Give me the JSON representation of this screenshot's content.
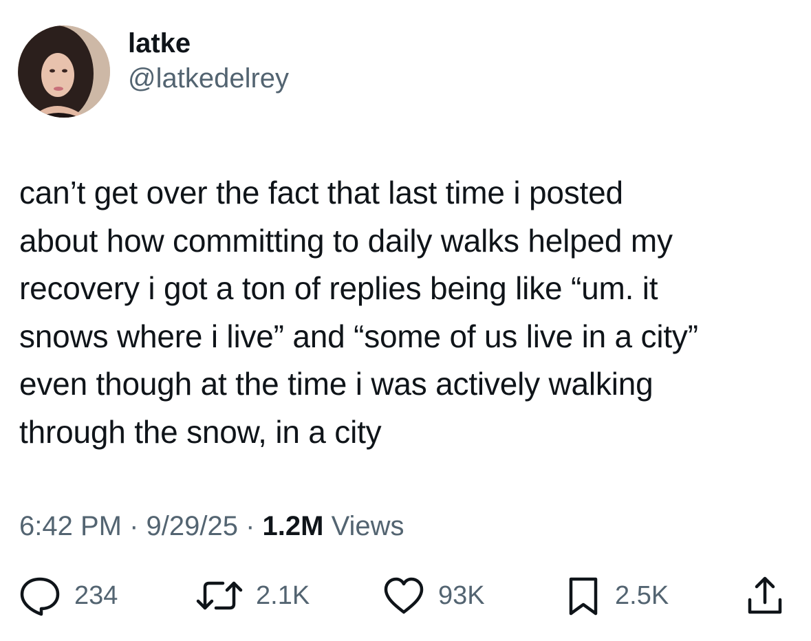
{
  "user": {
    "display_name": "latke",
    "handle": "@latkedelrey"
  },
  "tweet": {
    "text": "can’t get over the fact that last time i posted\nabout how committing to daily walks helped my\nrecovery i got a ton of replies being like “um. it\nsnows where i live” and “some of us live in a city”\neven though at the time i was actively walking\nthrough the snow, in a city",
    "time": "6:42 PM",
    "date": "9/29/25",
    "separator": " · ",
    "views_count": "1.2M",
    "views_label": " Views"
  },
  "actions": {
    "replies": {
      "icon": "reply-icon",
      "count": "234"
    },
    "reposts": {
      "icon": "repost-icon",
      "count": "2.1K"
    },
    "likes": {
      "icon": "heart-icon",
      "count": "93K"
    },
    "bookmarks": {
      "icon": "bookmark-icon",
      "count": "2.5K"
    },
    "share": {
      "icon": "share-icon"
    }
  },
  "colors": {
    "text_primary": "#0f1419",
    "text_secondary": "#536471",
    "background": "#ffffff"
  }
}
